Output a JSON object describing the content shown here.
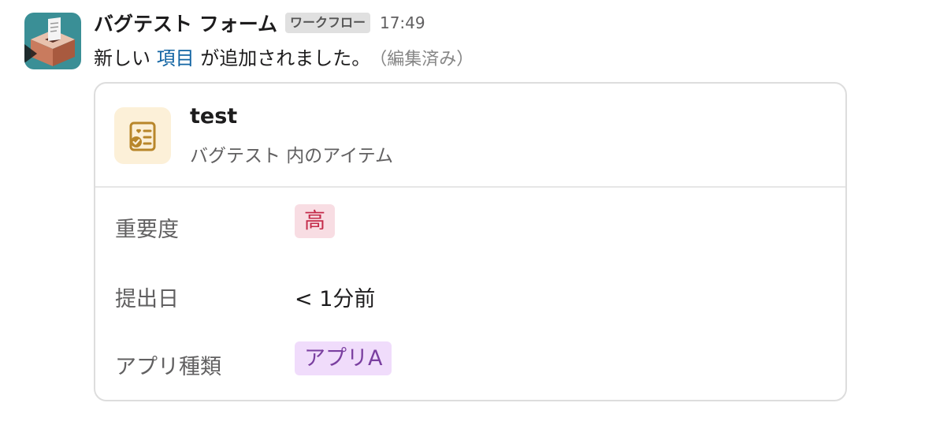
{
  "message": {
    "sender": "バグテスト フォーム",
    "app_badge": "ワークフロー",
    "time": "17:49",
    "text_before": "新しい",
    "link_text": "項目",
    "text_after": "が追加されました。",
    "edited": "（編集済み）",
    "avatar_icon": "ballot-box-icon"
  },
  "card": {
    "title": "test",
    "subtitle": "バグテスト 内のアイテム",
    "icon": "list-item-check-icon",
    "icon_bg": "#fcf0d8",
    "icon_color": "#b8862a",
    "fields": [
      {
        "label": "重要度",
        "value": "高",
        "style": "red-tag"
      },
      {
        "label": "提出日",
        "value": "< 1分前",
        "style": "plain"
      },
      {
        "label": "アプリ種類",
        "value": "アプリA",
        "style": "purple-tag"
      }
    ]
  },
  "colors": {
    "link": "#1264a3",
    "avatar_bg": "#3a8f96",
    "tag_red_bg": "#f8dde3",
    "tag_red_text": "#c42b4a",
    "tag_purple_bg": "#f0dcfb",
    "tag_purple_text": "#7a3fa0"
  }
}
